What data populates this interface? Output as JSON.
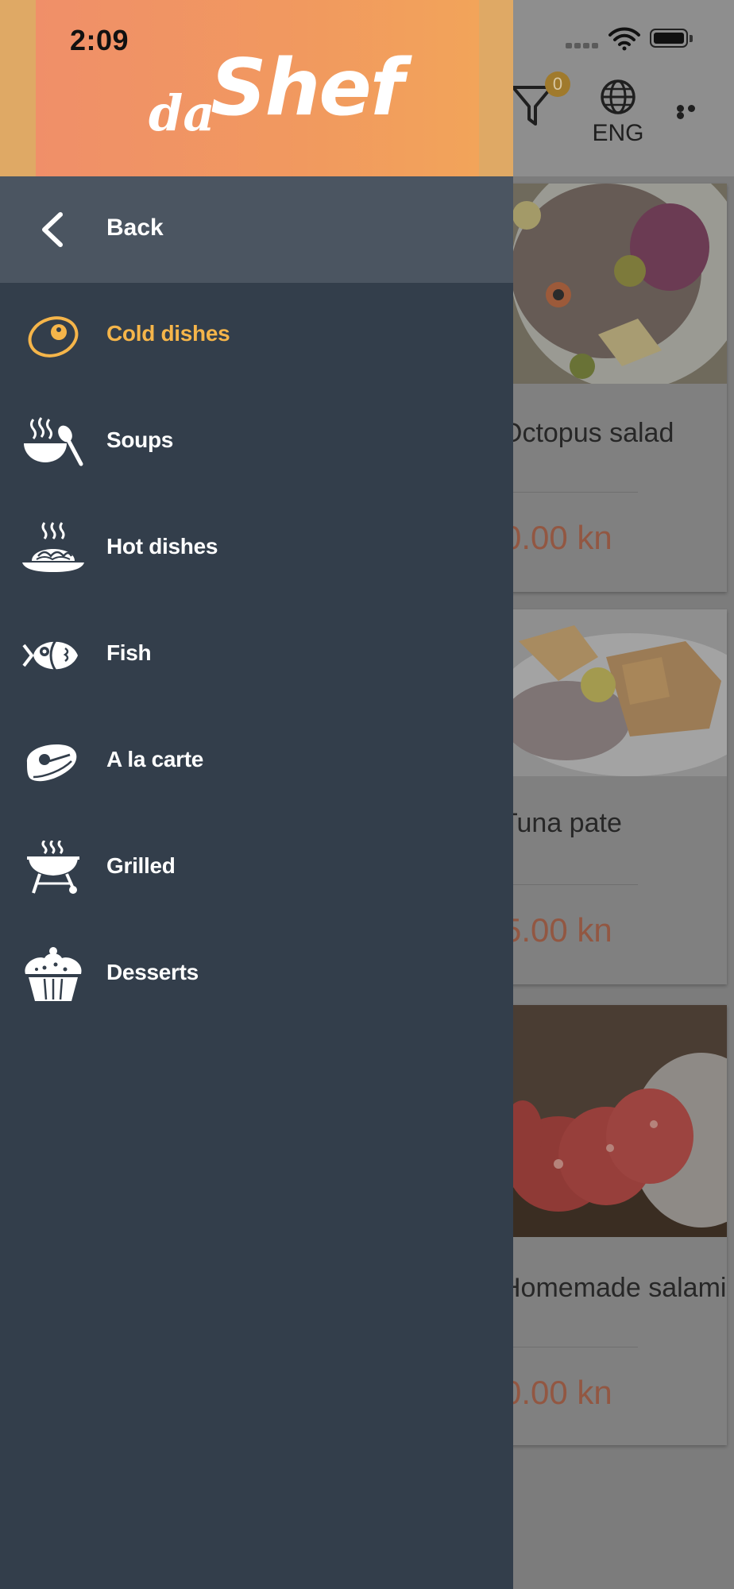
{
  "status_bar": {
    "time": "2:09"
  },
  "header": {
    "logo_da": "da",
    "logo_shef": "Shef",
    "filter_count": "0",
    "language": "ENG"
  },
  "background_cards": [
    {
      "name": "Octopus salad",
      "price": "0.00 kn"
    },
    {
      "name": "Tuna pate",
      "price": "5.00 kn"
    },
    {
      "name": "Homemade salami",
      "price": "0.00 kn"
    }
  ],
  "drawer": {
    "back_label": "Back",
    "items": [
      {
        "label": "Cold dishes",
        "icon": "cold-dishes-icon",
        "active": true
      },
      {
        "label": "Soups",
        "icon": "soup-bowl-icon",
        "active": false
      },
      {
        "label": "Hot dishes",
        "icon": "hot-dishes-icon",
        "active": false
      },
      {
        "label": "Fish",
        "icon": "fish-icon",
        "active": false
      },
      {
        "label": "A la carte",
        "icon": "steak-icon",
        "active": false
      },
      {
        "label": "Grilled",
        "icon": "grill-icon",
        "active": false
      },
      {
        "label": "Desserts",
        "icon": "cupcake-icon",
        "active": false
      }
    ]
  },
  "colors": {
    "drawer_bg": "#333e4b",
    "back_row_bg": "#4b5561",
    "active_accent": "#f5b54a",
    "logo_gradient_start": "#f08f69",
    "logo_gradient_end": "#f2a45a"
  }
}
